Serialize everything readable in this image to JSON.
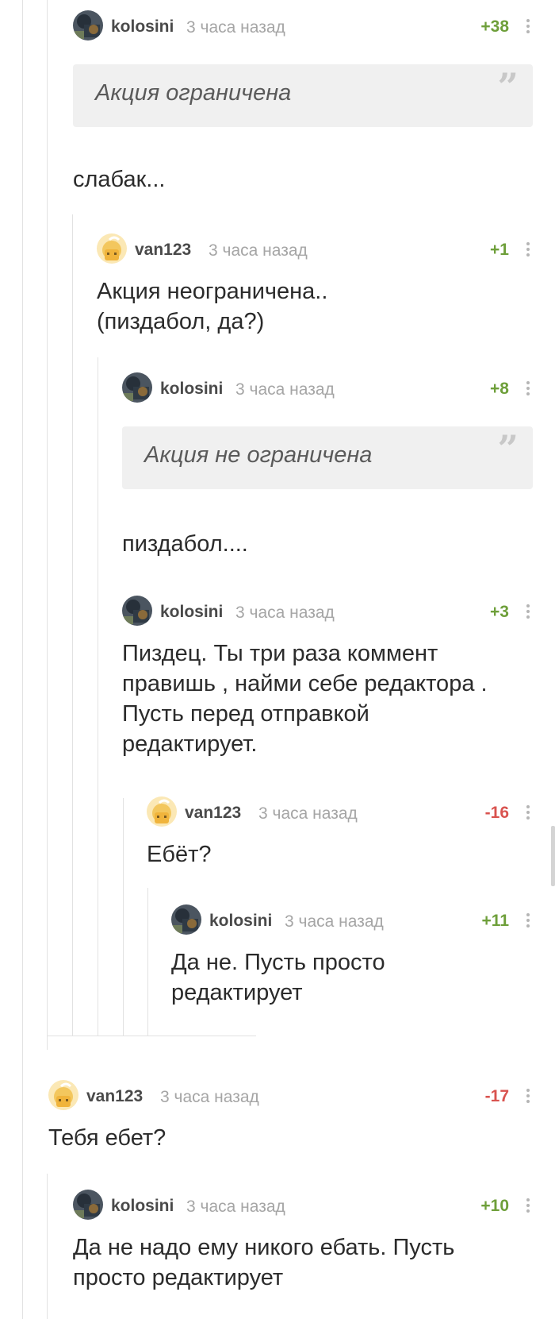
{
  "comments": [
    {
      "author": "kolosini",
      "time": "3 часа назад",
      "rating": "+38",
      "avatar": "kolosini-avatar"
    },
    {
      "author": "van123",
      "time": "3 часа назад",
      "rating": "+1",
      "text": "Акция неограничена..\n(пиздабол, да?)",
      "avatar": "van123-avatar"
    },
    {
      "author": "kolosini",
      "time": "3 часа назад",
      "rating": "+8",
      "avatar": "kolosini-avatar"
    },
    {
      "author": "kolosini",
      "time": "3 часа назад",
      "rating": "+3",
      "text": "Пиздец. Ты три раза коммент\nправишь , найми себе редактора .\nПусть перед отправкой\nредактирует.",
      "avatar": "kolosini-avatar"
    },
    {
      "author": "van123",
      "time": "3 часа назад",
      "rating": "-16",
      "text": "Ебёт?",
      "avatar": "van123-avatar"
    },
    {
      "author": "kolosini",
      "time": "3 часа назад",
      "rating": "+11",
      "text": "Да не. Пусть просто\nредактирует",
      "avatar": "kolosini-avatar"
    },
    {
      "author": "van123",
      "time": "3 часа назад",
      "rating": "-17",
      "text": "Тебя ебет?",
      "avatar": "van123-avatar"
    },
    {
      "author": "kolosini",
      "time": "3 часа назад",
      "rating": "+10",
      "text": "Да не надо ему никого ебать. Пусть\nпросто редактирует",
      "avatar": "kolosini-avatar"
    }
  ],
  "quotes": {
    "q1": "Акция ограничена",
    "q1_reply": "слабак...",
    "q2": "Акция не ограничена",
    "q2_reply": "пиздабол...."
  },
  "quote_mark": "”",
  "colors": {
    "positive": "#6e9f3a",
    "negative": "#d9534f",
    "muted": "#a5a5a5",
    "tree_line": "#e2e2e2"
  }
}
